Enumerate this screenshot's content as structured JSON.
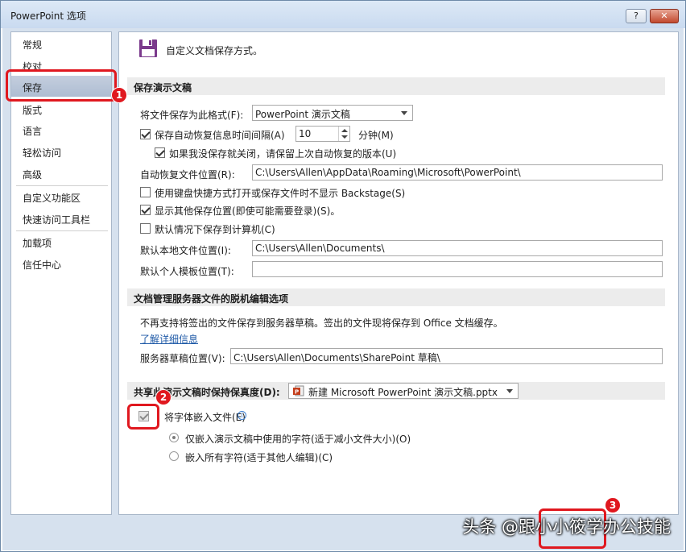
{
  "window": {
    "title": "PowerPoint 选项",
    "help_label": "?",
    "close_label": "✕"
  },
  "sidebar": {
    "items": [
      {
        "label": "常规"
      },
      {
        "label": "校对"
      },
      {
        "label": "保存",
        "selected": true
      },
      {
        "label": "版式"
      },
      {
        "label": "语言"
      },
      {
        "label": "轻松访问"
      },
      {
        "label": "高级"
      },
      {
        "label": "自定义功能区"
      },
      {
        "label": "快速访问工具栏"
      },
      {
        "label": "加载项"
      },
      {
        "label": "信任中心"
      }
    ]
  },
  "main": {
    "header_text": "自定义文档保存方式。",
    "save_section": {
      "title": "保存演示文稿",
      "format_label": "将文件保存为此格式(F):",
      "format_value": "PowerPoint 演示文稿",
      "autorecover_label": "保存自动恢复信息时间间隔(A)",
      "autorecover_checked": true,
      "autorecover_minutes": "10",
      "minutes_label": "分钟(M)",
      "keep_last_label": "如果我没保存就关闭，请保留上次自动恢复的版本(U)",
      "keep_last_checked": true,
      "autorecover_location_label": "自动恢复文件位置(R):",
      "autorecover_location_value": "C:\\Users\\Allen\\AppData\\Roaming\\Microsoft\\PowerPoint\\",
      "no_backstage_label": "使用键盘快捷方式打开或保存文件时不显示 Backstage(S)",
      "no_backstage_checked": false,
      "show_other_label": "显示其他保存位置(即使可能需要登录)(S)。",
      "show_other_checked": true,
      "default_computer_label": "默认情况下保存到计算机(C)",
      "default_computer_checked": false,
      "local_location_label": "默认本地文件位置(I):",
      "local_location_value": "C:\\Users\\Allen\\Documents\\",
      "template_location_label": "默认个人模板位置(T):",
      "template_location_value": ""
    },
    "offline_section": {
      "title": "文档管理服务器文件的脱机编辑选项",
      "description": "不再支持将签出的文件保存到服务器草稿。签出的文件现将保存到 Office 文档缓存。",
      "learn_more": "了解详细信息",
      "drafts_label": "服务器草稿位置(V):",
      "drafts_value": "C:\\Users\\Allen\\Documents\\SharePoint 草稿\\"
    },
    "fidelity_section": {
      "title": "共享此演示文稿时保持保真度(D):",
      "file_value": "新建 Microsoft PowerPoint 演示文稿.pptx",
      "embed_label": "将字体嵌入文件(E)",
      "embed_checked": true,
      "only_used_label": "仅嵌入演示文稿中使用的字符(适于减小文件大小)(O)",
      "all_chars_label": "嵌入所有字符(适于其他人编辑)(C)"
    }
  },
  "annotations": {
    "badge1": "1",
    "badge2": "2",
    "badge3": "3"
  },
  "watermark": "头条 @跟小小筱学办公技能",
  "colors": {
    "accent_red": "#e0181f",
    "save_icon": "#7b3a8c",
    "link": "#1f5aa7"
  }
}
